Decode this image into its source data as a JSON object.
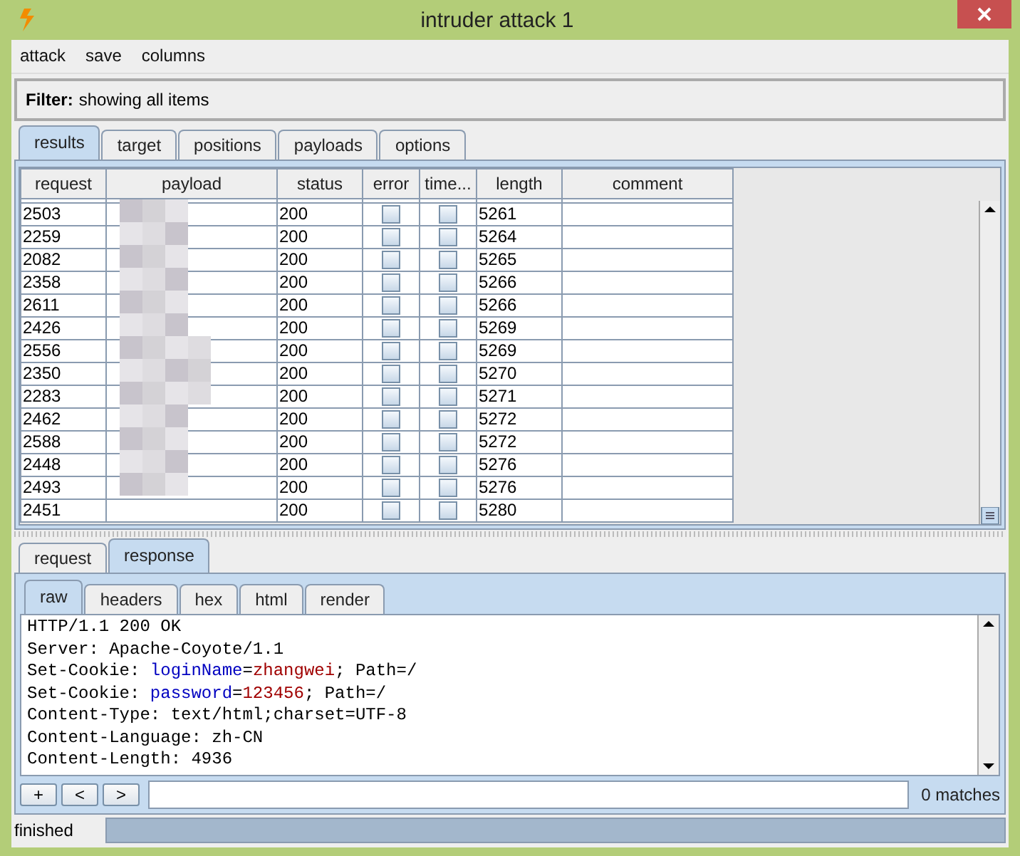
{
  "window": {
    "title": "intruder attack 1"
  },
  "menu": [
    "attack",
    "save",
    "columns"
  ],
  "filter": {
    "label": "Filter:",
    "text": "showing all items"
  },
  "tabs": [
    {
      "label": "results",
      "selected": true
    },
    {
      "label": "target",
      "selected": false
    },
    {
      "label": "positions",
      "selected": false
    },
    {
      "label": "payloads",
      "selected": false
    },
    {
      "label": "options",
      "selected": false
    }
  ],
  "table": {
    "columns": [
      "request",
      "payload",
      "status",
      "error",
      "time...",
      "length",
      "comment"
    ],
    "rows": [
      {
        "request": "2503",
        "status": "200",
        "error": false,
        "timeout": false,
        "length": "5261"
      },
      {
        "request": "2259",
        "status": "200",
        "error": false,
        "timeout": false,
        "length": "5264"
      },
      {
        "request": "2082",
        "status": "200",
        "error": false,
        "timeout": false,
        "length": "5265"
      },
      {
        "request": "2358",
        "status": "200",
        "error": false,
        "timeout": false,
        "length": "5266"
      },
      {
        "request": "2611",
        "status": "200",
        "error": false,
        "timeout": false,
        "length": "5266"
      },
      {
        "request": "2426",
        "status": "200",
        "error": false,
        "timeout": false,
        "length": "5269"
      },
      {
        "request": "2556",
        "status": "200",
        "error": false,
        "timeout": false,
        "length": "5269"
      },
      {
        "request": "2350",
        "status": "200",
        "error": false,
        "timeout": false,
        "length": "5270"
      },
      {
        "request": "2283",
        "status": "200",
        "error": false,
        "timeout": false,
        "length": "5271"
      },
      {
        "request": "2462",
        "status": "200",
        "error": false,
        "timeout": false,
        "length": "5272"
      },
      {
        "request": "2588",
        "status": "200",
        "error": false,
        "timeout": false,
        "length": "5272"
      },
      {
        "request": "2448",
        "status": "200",
        "error": false,
        "timeout": false,
        "length": "5276"
      },
      {
        "request": "2493",
        "status": "200",
        "error": false,
        "timeout": false,
        "length": "5276"
      },
      {
        "request": "2451",
        "status": "200",
        "error": false,
        "timeout": false,
        "length": "5280"
      }
    ]
  },
  "message_tabs": [
    {
      "label": "request",
      "selected": false
    },
    {
      "label": "response",
      "selected": true
    }
  ],
  "view_tabs": [
    {
      "label": "raw",
      "selected": true
    },
    {
      "label": "headers",
      "selected": false
    },
    {
      "label": "hex",
      "selected": false
    },
    {
      "label": "html",
      "selected": false
    },
    {
      "label": "render",
      "selected": false
    }
  ],
  "response_lines": [
    [
      {
        "kind": "plain",
        "text": "HTTP/1.1 200 OK"
      }
    ],
    [
      {
        "kind": "plain",
        "text": "Server: Apache-Coyote/1.1"
      }
    ],
    [
      {
        "kind": "plain",
        "text": "Set-Cookie: "
      },
      {
        "kind": "name",
        "text": "loginName"
      },
      {
        "kind": "plain",
        "text": "="
      },
      {
        "kind": "value",
        "text": "zhangwei"
      },
      {
        "kind": "plain",
        "text": "; Path=/"
      }
    ],
    [
      {
        "kind": "plain",
        "text": "Set-Cookie: "
      },
      {
        "kind": "name",
        "text": "password"
      },
      {
        "kind": "plain",
        "text": "="
      },
      {
        "kind": "value",
        "text": "123456"
      },
      {
        "kind": "plain",
        "text": "; Path=/"
      }
    ],
    [
      {
        "kind": "plain",
        "text": "Content-Type: text/html;charset=UTF-8"
      }
    ],
    [
      {
        "kind": "plain",
        "text": "Content-Language: zh-CN"
      }
    ],
    [
      {
        "kind": "plain",
        "text": "Content-Length: 4936"
      }
    ]
  ],
  "search": {
    "buttons": [
      "+",
      "<",
      ">"
    ],
    "matches": "0 matches"
  },
  "status_bar": {
    "text": "finished",
    "level": 1
  }
}
